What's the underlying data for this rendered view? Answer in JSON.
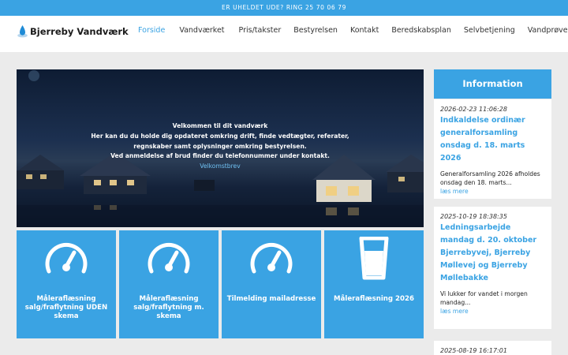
{
  "topbar": {
    "text": "ER UHELDET UDE? RING 25 70 06 79"
  },
  "header": {
    "logo_text": "Bjerreby Vandværk",
    "nav": [
      "Forside",
      "Vandværket",
      "Pris/takster",
      "Bestyrelsen",
      "Kontakt",
      "Beredskabsplan",
      "Selvbetjening",
      "Vandprøver"
    ],
    "active": "Forside"
  },
  "hero": {
    "line1": "Velkommen til dit vandværk",
    "line2": "Her kan du du holde dig opdateret omkring drift, finde vedtægter, referater,",
    "line3": "regnskaber samt oplysninger omkring bestyrelsen.",
    "line4": "Ved anmeldelse af brud finder du telefonnummer under kontakt.",
    "link": "Velkomstbrev"
  },
  "tiles": [
    {
      "label": "Måleraflæsning salg/fraflytning UDEN skema",
      "icon": "gauge-icon"
    },
    {
      "label": "Måleraflæsning salg/fraflytning m. skema",
      "icon": "gauge-icon"
    },
    {
      "label": "Tilmelding mailadresse",
      "icon": "gauge-icon"
    },
    {
      "label": "Måleraflæsning 2026",
      "icon": "water-glass-icon"
    }
  ],
  "sidebar": {
    "heading": "Information",
    "posts": [
      {
        "date": "2026-02-23 11:06:28",
        "title": "Indkaldelse ordinær generalforsamling onsdag d. 18. marts 2026",
        "excerpt": "Generalforsamling 2026 afholdes onsdag den 18. marts...",
        "more": "læs mere"
      },
      {
        "date": "2025-10-19 18:38:35",
        "title": "Ledningsarbejde mandag d. 20. oktober Bjerrebyvej, Bjerreby Møllevej og Bjerreby Møllebakke",
        "excerpt": "Vi lukker for vandet i morgen mandag...",
        "more": "læs mere"
      },
      {
        "date": "2025-08-19 16:17:01"
      }
    ]
  },
  "colors": {
    "accent": "#3aa3e3",
    "background": "#ebebeb"
  }
}
